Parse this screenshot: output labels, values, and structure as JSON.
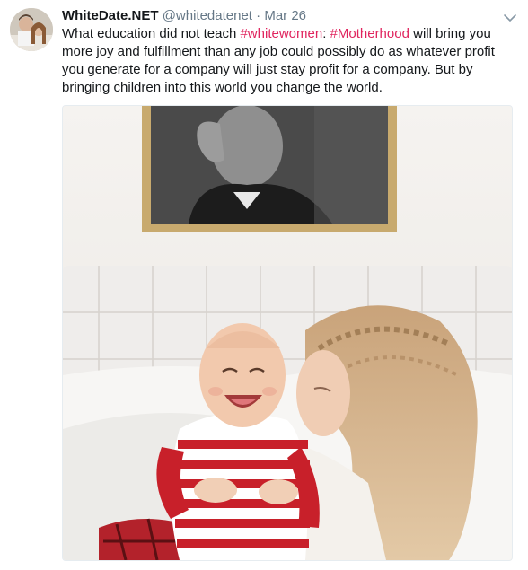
{
  "tweet": {
    "author_name": "WhiteDate.NET",
    "author_handle": "@whitedatenet",
    "separator": "·",
    "date": "Mar 26",
    "text_part1": "What education did not teach ",
    "hashtag1": "#whitewomen",
    "text_part2": ": ",
    "hashtag2": "#Motherhood",
    "text_part3": " will bring you more joy and fulfillment than any job could possibly do as whatever profit you generate for a company will just stay profit for a company. But by bringing children into this world you change the world."
  },
  "colors": {
    "hashtag": "#e0245e",
    "secondary_text": "#657786",
    "primary_text": "#14171a"
  },
  "icons": {
    "menu": "chevron-down-icon",
    "avatar": "avatar"
  }
}
